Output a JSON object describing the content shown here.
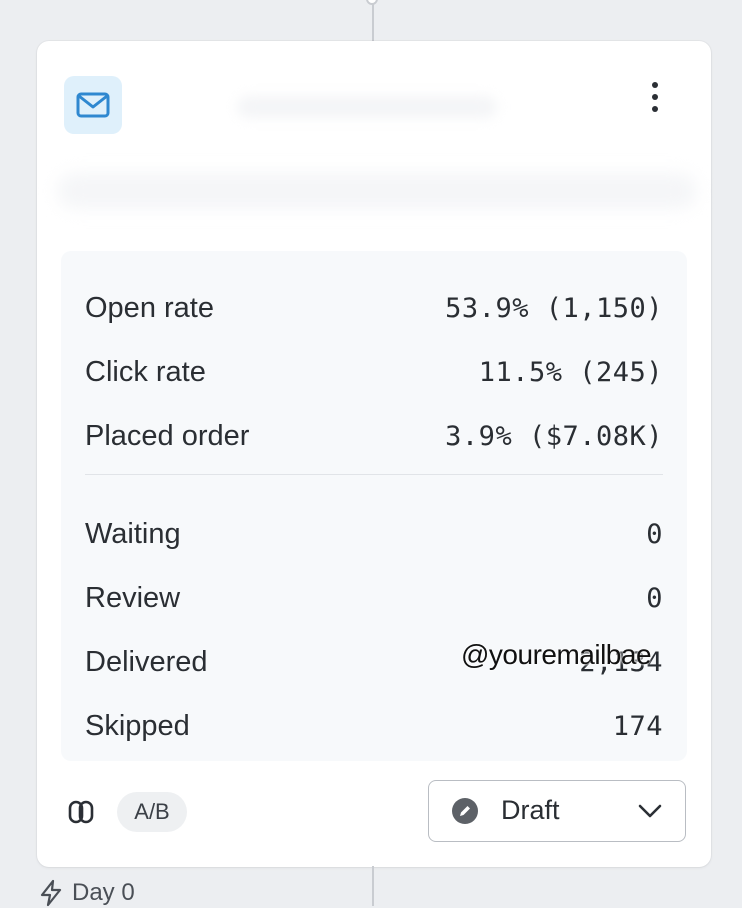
{
  "stats": {
    "open_rate": {
      "label": "Open rate",
      "value": "53.9% (1,150)"
    },
    "click_rate": {
      "label": "Click rate",
      "value": "11.5% (245)"
    },
    "placed_order": {
      "label": "Placed order",
      "value": "3.9% ($7.08K)"
    }
  },
  "counts": {
    "waiting": {
      "label": "Waiting",
      "value": "0"
    },
    "review": {
      "label": "Review",
      "value": "0"
    },
    "delivered": {
      "label": "Delivered",
      "value": "2,134"
    },
    "skipped": {
      "label": "Skipped",
      "value": "174"
    }
  },
  "watermark": "@youremailbae",
  "footer": {
    "ab_badge": "A/B",
    "status_select": "Draft"
  },
  "day_label": "Day 0",
  "icons": {
    "header": "mail-icon",
    "menu": "kebab-menu-icon",
    "link": "link-icon",
    "status": "draft-status-icon",
    "dropdown": "chevron-down-icon",
    "trigger": "lightning-icon"
  },
  "colors": {
    "icon_accent": "#2f88d0",
    "icon_bg": "#dff0fb"
  }
}
